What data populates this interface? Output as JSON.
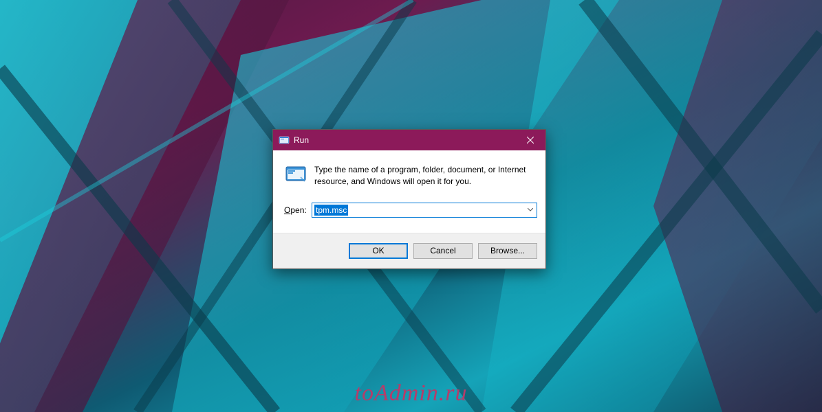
{
  "dialog": {
    "title": "Run",
    "description": "Type the name of a program, folder, document, or Internet resource, and Windows will open it for you.",
    "open_label": "Open:",
    "input_value": "tpm.msc",
    "buttons": {
      "ok": "OK",
      "cancel": "Cancel",
      "browse": "Browse..."
    }
  },
  "watermark": "toAdmin.ru"
}
